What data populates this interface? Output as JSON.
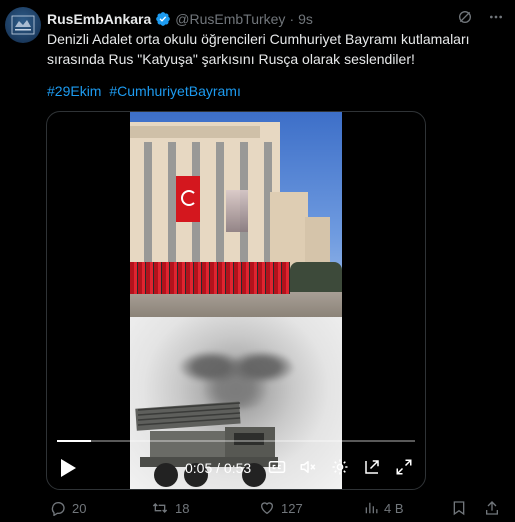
{
  "author": {
    "name": "RusEmbAnkara",
    "handle": "@RusEmbTurkey",
    "separator": "·",
    "time": "9s",
    "verified_color": "#1d9bf0"
  },
  "tweet": {
    "text": "Denizli Adalet orta okulu öğrencileri Cumhuriyet Bayramı kutlamaları sırasında Rus \"Katyuşa\" şarkısını Rusça olarak seslendiler!",
    "hashtags": [
      "#29Ekim",
      "#CumhuriyetBayramı"
    ]
  },
  "video": {
    "elapsed": "0:05",
    "duration": "0:53",
    "time_separator": "/",
    "progress_fraction": 0.094,
    "controls": [
      "play-icon",
      "captions-icon",
      "mute-icon",
      "settings-icon",
      "popout-icon",
      "fullscreen-icon"
    ]
  },
  "actions": {
    "replies": "20",
    "retweets": "18",
    "likes": "127",
    "views": "4 B"
  },
  "colors": {
    "background": "#000000",
    "text": "#e7e9ea",
    "muted": "#71767b",
    "accent": "#1d9bf0"
  }
}
